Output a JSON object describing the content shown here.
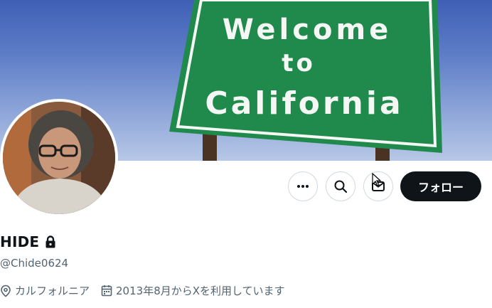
{
  "banner": {
    "sign_line1": "Welcome",
    "sign_line2": "to",
    "sign_line3": "California",
    "sky_color": "#4a6bbf",
    "sign_color": "#1f8a4c"
  },
  "actions": {
    "more_icon": "more-icon",
    "search_icon": "search-icon",
    "message_icon": "message-icon",
    "follow_label": "フォロー"
  },
  "profile": {
    "name": "HIDE",
    "protected_icon": "lock-icon",
    "handle": "@Chide0624",
    "location_icon": "location-icon",
    "location": "カルフォルニア",
    "joined_icon": "calendar-icon",
    "joined": "2013年8月からXを利用しています"
  }
}
